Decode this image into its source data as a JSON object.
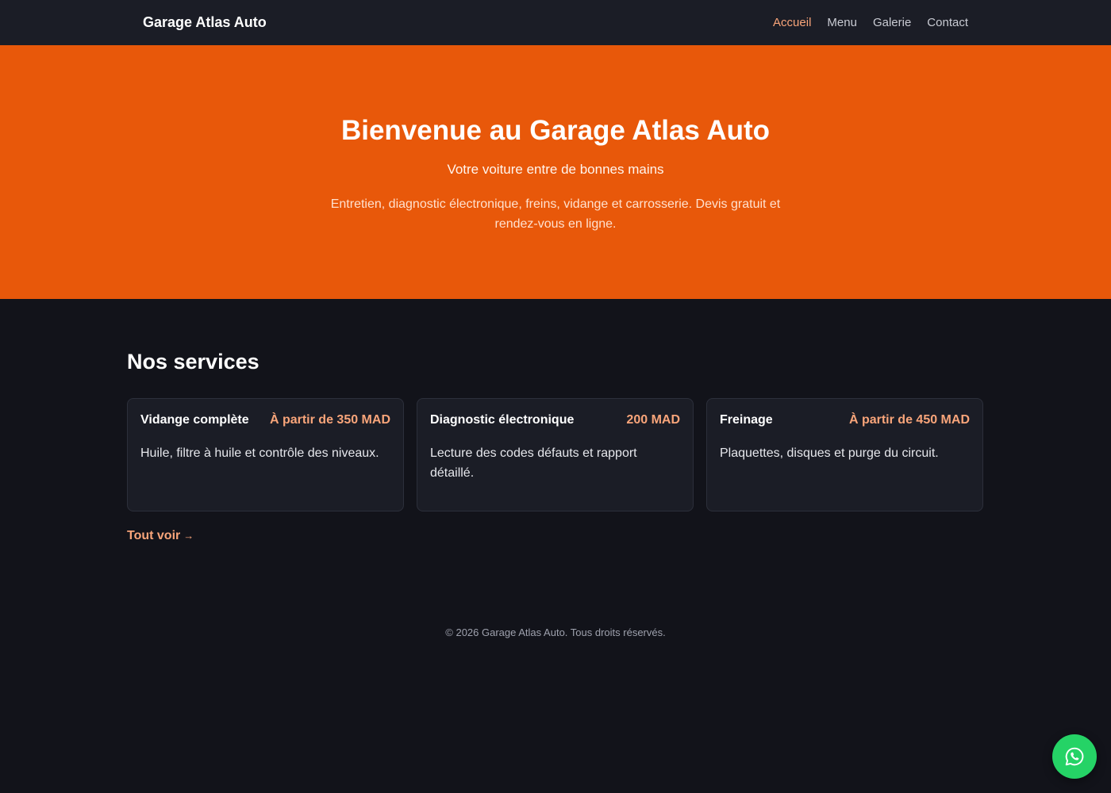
{
  "header": {
    "brand": "Garage Atlas Auto",
    "nav": [
      {
        "label": "Accueil",
        "active": true
      },
      {
        "label": "Menu",
        "active": false
      },
      {
        "label": "Galerie",
        "active": false
      },
      {
        "label": "Contact",
        "active": false
      }
    ]
  },
  "hero": {
    "title": "Bienvenue au Garage Atlas Auto",
    "subtitle": "Votre voiture entre de bonnes mains",
    "description": "Entretien, diagnostic électronique, freins, vidange et carrosserie. Devis gratuit et rendez-vous en ligne."
  },
  "services": {
    "heading": "Nos services",
    "items": [
      {
        "title": "Vidange complète",
        "price": "À partir de 350 MAD",
        "description": "Huile, filtre à huile et contrôle des niveaux."
      },
      {
        "title": "Diagnostic électronique",
        "price": "200 MAD",
        "description": "Lecture des codes défauts et rapport détaillé."
      },
      {
        "title": "Freinage",
        "price": "À partir de 450 MAD",
        "description": "Plaquettes, disques et purge du circuit."
      }
    ],
    "see_all_label": "Tout voir",
    "see_all_arrow": "→"
  },
  "footer": {
    "text": "© 2026 Garage Atlas Auto. Tous droits réservés."
  },
  "whatsapp": {
    "icon": "whatsapp-icon"
  },
  "colors": {
    "accent": "#e8580a",
    "accent_text": "#f9a57a",
    "background": "#12131a",
    "surface": "#1b1d26",
    "whatsapp": "#25d366"
  }
}
